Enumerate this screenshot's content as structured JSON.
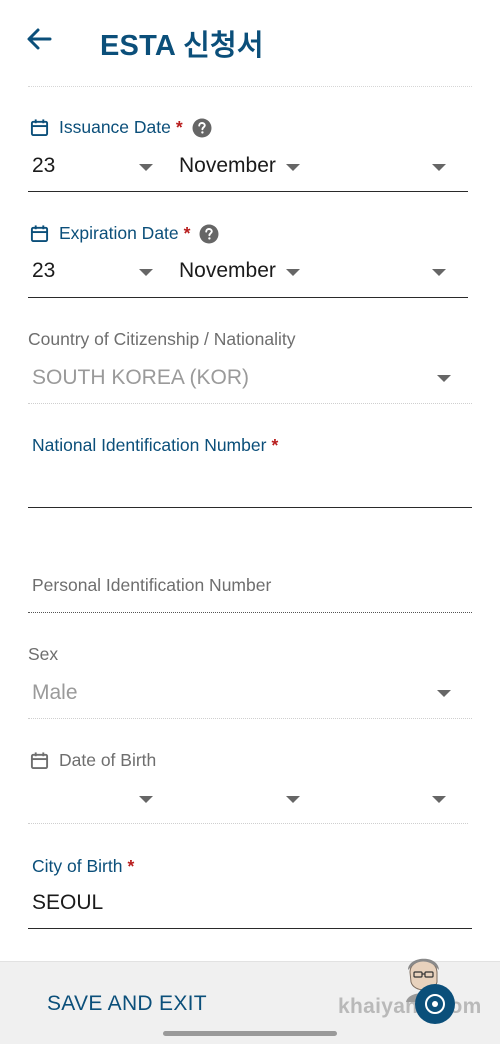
{
  "header": {
    "title": "ESTA 신청서",
    "back_icon": "arrow-left-icon"
  },
  "issuance": {
    "label": "Issuance Date",
    "required": "*",
    "day": "23",
    "month": "November",
    "year": ""
  },
  "expiration": {
    "label": "Expiration Date",
    "required": "*",
    "day": "23",
    "month": "November",
    "year": ""
  },
  "citizenship": {
    "label": "Country of Citizenship / Nationality",
    "value": "SOUTH KOREA (KOR)"
  },
  "national_id": {
    "label": "National Identification Number",
    "required": "*",
    "value": ""
  },
  "personal_id": {
    "placeholder": "Personal Identification Number",
    "value": ""
  },
  "sex": {
    "label": "Sex",
    "value": "Male"
  },
  "dob": {
    "label": "Date of Birth",
    "day": "",
    "month": "",
    "year": ""
  },
  "city_of_birth": {
    "label": "City of Birth",
    "required": "*",
    "value": "SEOUL"
  },
  "footer": {
    "save_exit": "SAVE AND EXIT",
    "watermark": "khaiyang.com"
  },
  "colors": {
    "primary": "#0b4f7a",
    "required": "#b81c1c",
    "muted": "#9a9a9a"
  }
}
